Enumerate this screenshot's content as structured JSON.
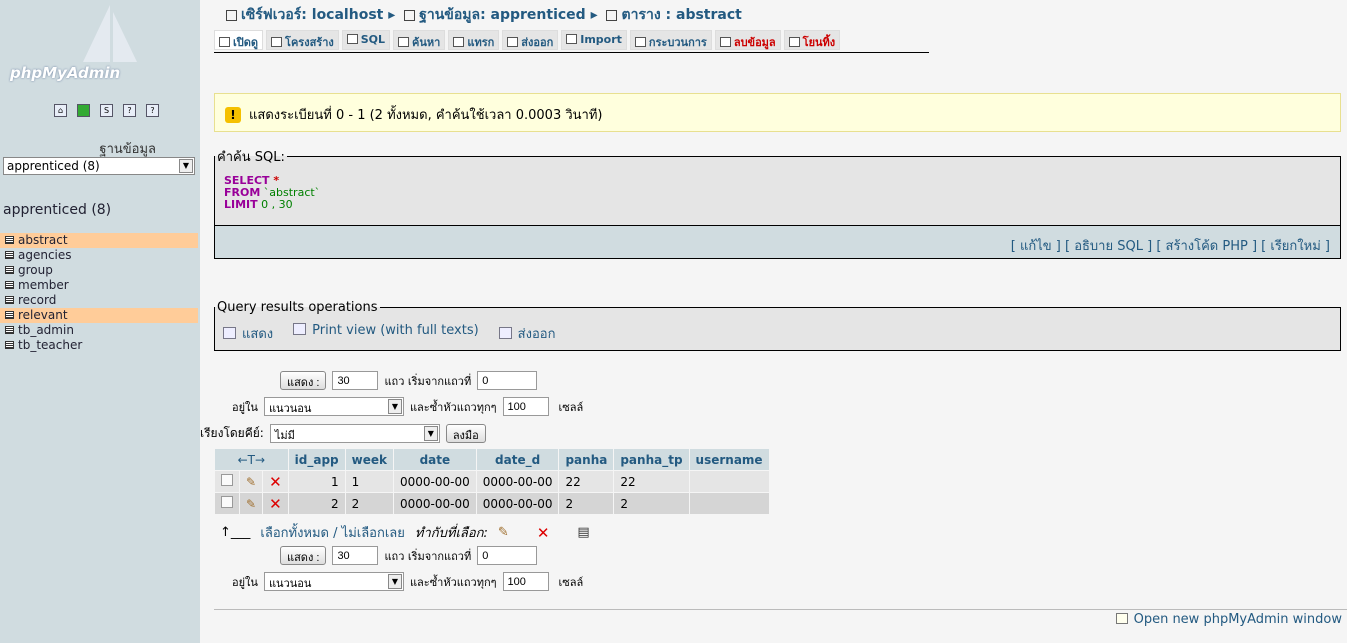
{
  "sidebar": {
    "logo": "phpMyAdmin",
    "db_label": "ฐานข้อมูล",
    "db_selected": "apprenticed (8)",
    "db_title": "apprenticed (8)",
    "tables": [
      {
        "name": "abstract",
        "highlight": true
      },
      {
        "name": "agencies",
        "highlight": false
      },
      {
        "name": "group",
        "highlight": false
      },
      {
        "name": "member",
        "highlight": false
      },
      {
        "name": "record",
        "highlight": false
      },
      {
        "name": "relevant",
        "highlight": true
      },
      {
        "name": "tb_admin",
        "highlight": false
      },
      {
        "name": "tb_teacher",
        "highlight": false
      }
    ]
  },
  "breadcrumb": {
    "server": "เซิร์ฟเวอร์: localhost",
    "database": "ฐานข้อมูล: apprenticed",
    "table": "ตาราง : abstract"
  },
  "tabs": [
    {
      "label": "เปิดดู",
      "red": false
    },
    {
      "label": "โครงสร้าง",
      "red": false
    },
    {
      "label": "SQL",
      "red": false
    },
    {
      "label": "ค้นหา",
      "red": false
    },
    {
      "label": "แทรก",
      "red": false
    },
    {
      "label": "ส่งออก",
      "red": false
    },
    {
      "label": "Import",
      "red": false
    },
    {
      "label": "กระบวนการ",
      "red": false
    },
    {
      "label": "ลบข้อมูล",
      "red": true
    },
    {
      "label": "โยนทิ้ง",
      "red": true
    }
  ],
  "notice": "แสดงระเบียนที่ 0 - 1 (2 ทั้งหมด, คำค้นใช้เวลา 0.0003 วินาที)",
  "sql": {
    "legend": "คำค้น SQL:",
    "select": "SELECT",
    "star": " *",
    "from": "FROM",
    "table": " `abstract`",
    "limit": "LIMIT",
    "limit_val": " 0 , 30",
    "links": [
      "แก้ไข",
      "อธิบาย SQL",
      "สร้างโค้ด PHP",
      "เรียกใหม่"
    ]
  },
  "qro": {
    "legend": "Query results operations",
    "items": [
      "แสดง",
      "Print view (with full texts)",
      "ส่งออก"
    ]
  },
  "nav": {
    "show_btn": "แสดง :",
    "rows": "30",
    "rows_label": "แถว เริ่มจากแถวที่",
    "start": "0",
    "in_label": "อยู่ใน",
    "mode": "แนวนอน",
    "repeat_label": "และซ้ำหัวแถวทุกๆ",
    "repeat": "100",
    "cells_label": "เซลล์"
  },
  "sort": {
    "label": "เรียงโดยคีย์:",
    "value": "ไม่มี",
    "go": "ลงมือ"
  },
  "table": {
    "arrows": "←T→",
    "columns": [
      "id_app",
      "week",
      "date",
      "date_d",
      "panha",
      "panha_tp",
      "username"
    ],
    "rows": [
      [
        "1",
        "1",
        "0000-00-00",
        "0000-00-00",
        "22",
        "22",
        ""
      ],
      [
        "2",
        "2",
        "0000-00-00",
        "0000-00-00",
        "2",
        "2",
        ""
      ]
    ]
  },
  "bulk": {
    "check_all": "เลือกทั้งหมด",
    "sep": " / ",
    "uncheck_all": "ไม่เลือกเลย",
    "with_selected": "ทำกับที่เลือก:"
  },
  "footer": {
    "new_window": "Open new phpMyAdmin window"
  }
}
